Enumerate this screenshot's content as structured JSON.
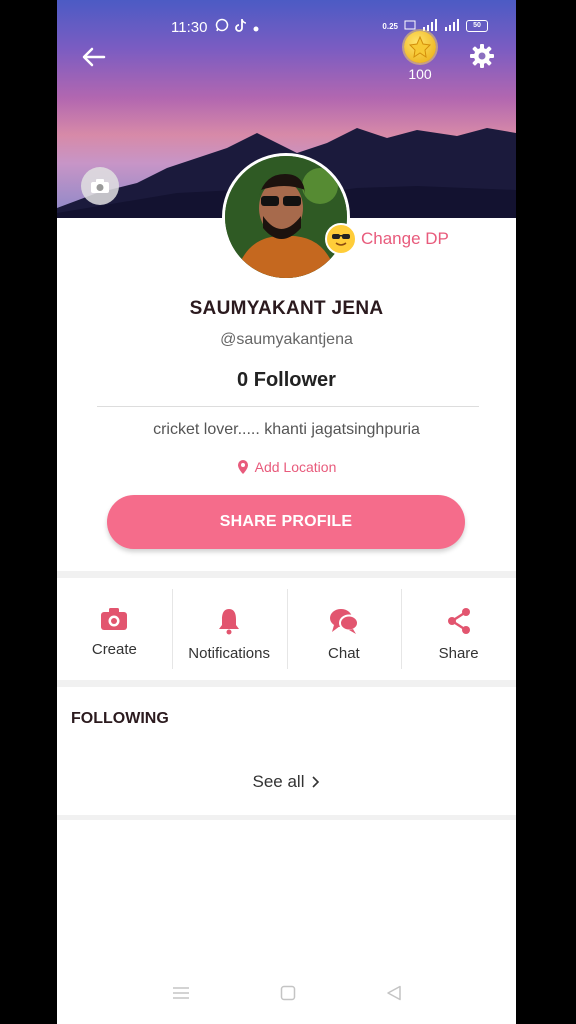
{
  "status_bar": {
    "time": "11:30",
    "net_speed": "0.25",
    "battery": "50"
  },
  "header": {
    "coins": "100"
  },
  "profile": {
    "change_dp_label": "Change DP",
    "name": "SAUMYAKANT JENA",
    "handle": "@saumyakantjena",
    "followers": "0 Follower",
    "bio": "cricket lover..... khanti jagatsinghpuria",
    "location_label": "Add Location",
    "share_label": "SHARE PROFILE"
  },
  "actions": [
    {
      "label": "Create",
      "icon": "camera-icon"
    },
    {
      "label": "Notifications",
      "icon": "bell-icon"
    },
    {
      "label": "Chat",
      "icon": "chat-icon"
    },
    {
      "label": "Share",
      "icon": "share-icon"
    }
  ],
  "following": {
    "title": "FOLLOWING",
    "see_all": "See all"
  },
  "colors": {
    "accent": "#f56c8b",
    "accent_text": "#e85b7c",
    "icon": "#e2556f"
  }
}
